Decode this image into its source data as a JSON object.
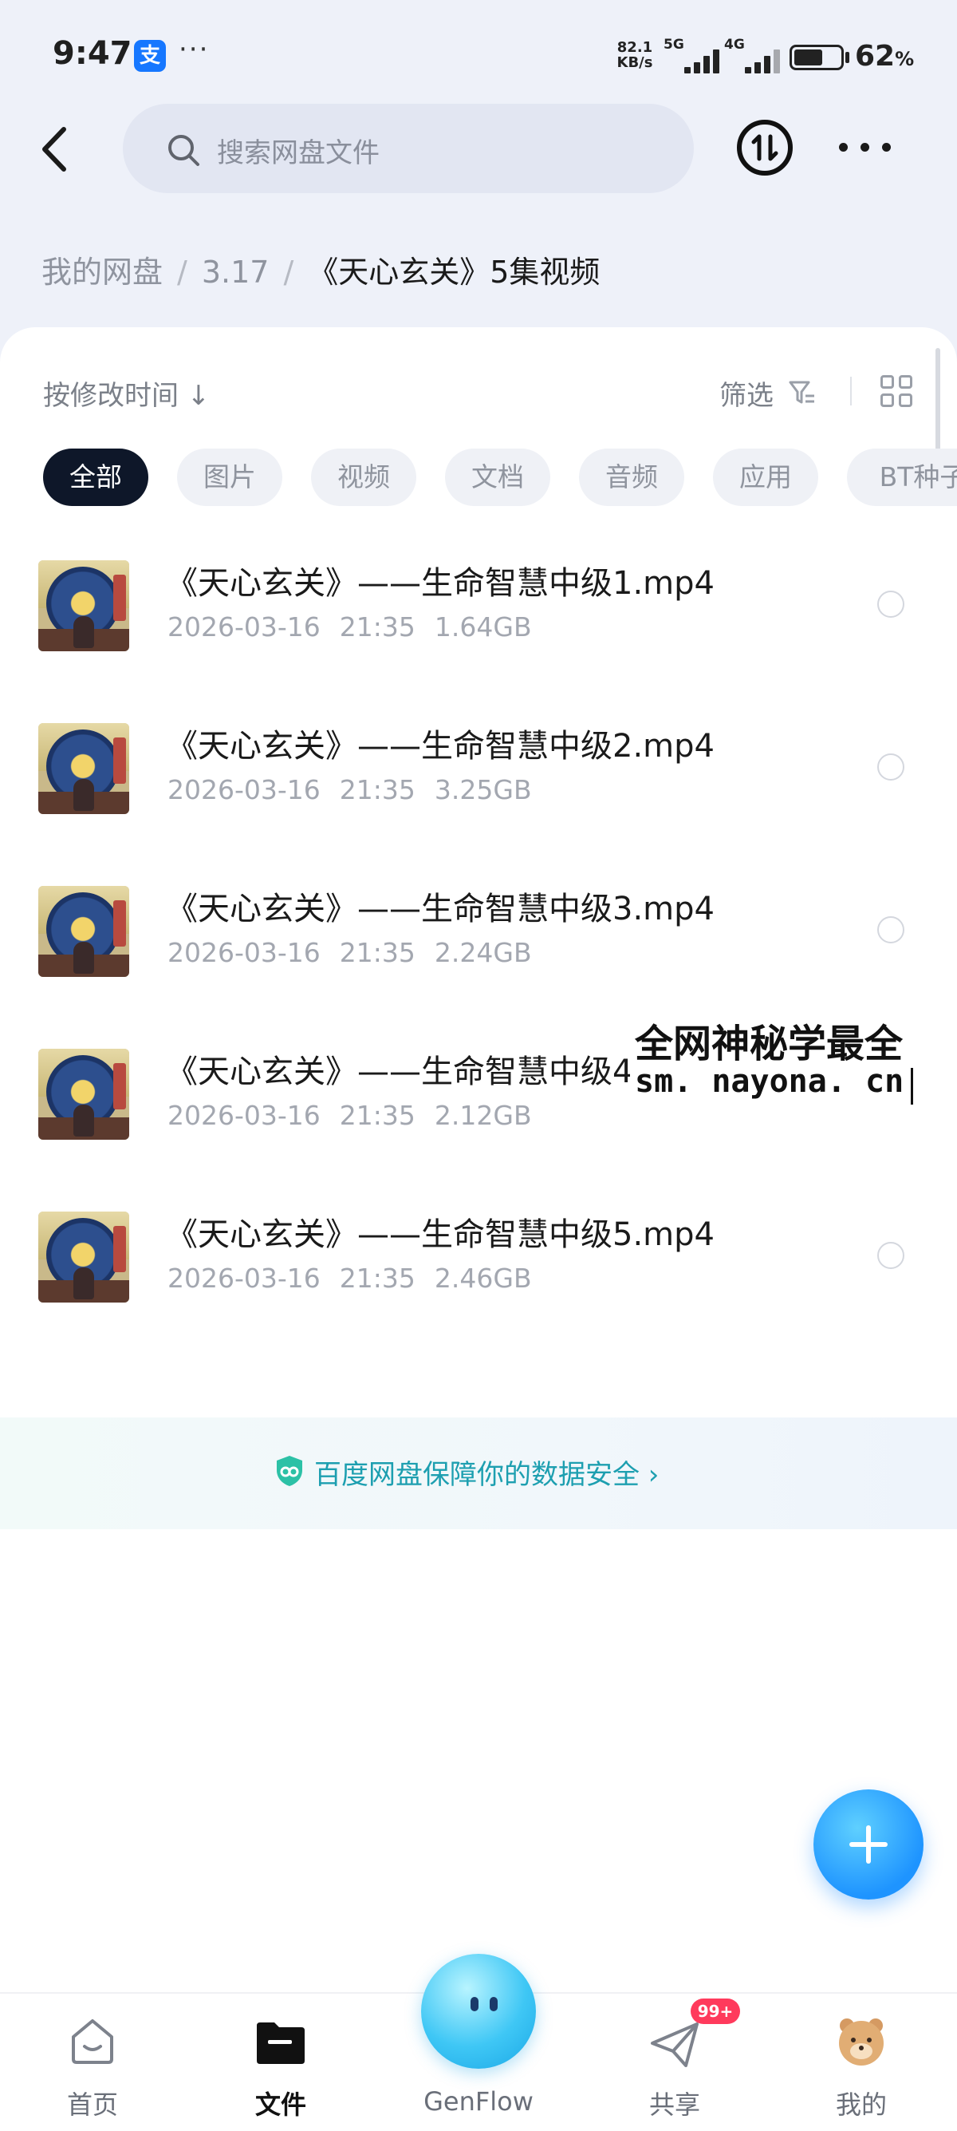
{
  "status_bar": {
    "time": "9:47",
    "app_badge": "支",
    "more": "···",
    "net_speed": [
      "82.1",
      "KB/s"
    ],
    "sim1": "5G",
    "sim2": "4G",
    "battery_percent": "62",
    "battery_unit": "%",
    "battery_level": 0.62
  },
  "header": {
    "search_placeholder": "搜索网盘文件",
    "transfer_icon": "transfer-icon",
    "more_icon": "more-icon"
  },
  "breadcrumb": {
    "items": [
      "我的网盘",
      "3.17"
    ],
    "separator": "/",
    "current": "《天心玄关》5集视频"
  },
  "toolbar": {
    "sort_label": "按修改时间 ↓",
    "filter_label": "筛选"
  },
  "categories": [
    "全部",
    "图片",
    "视频",
    "文档",
    "音频",
    "应用",
    "BT种子"
  ],
  "active_category": "全部",
  "files": [
    {
      "name": "《天心玄关》——生命智慧中级1.mp4",
      "date": "2026-03-16",
      "time": "21:35",
      "size": "1.64GB"
    },
    {
      "name": "《天心玄关》——生命智慧中级2.mp4",
      "date": "2026-03-16",
      "time": "21:35",
      "size": "3.25GB"
    },
    {
      "name": "《天心玄关》——生命智慧中级3.mp4",
      "date": "2026-03-16",
      "time": "21:35",
      "size": "2.24GB"
    },
    {
      "name": "《天心玄关》——生命智慧中级4.mp4",
      "date": "2026-03-16",
      "time": "21:35",
      "size": "2.12GB"
    },
    {
      "name": "《天心玄关》——生命智慧中级5.mp4",
      "date": "2026-03-16",
      "time": "21:35",
      "size": "2.46GB"
    }
  ],
  "watermark": {
    "line1": "全网神秘学最全",
    "line2": "sm. nayona. cn"
  },
  "security_banner": {
    "text": "百度网盘保障你的数据安全 ›"
  },
  "bottom_nav": {
    "home": "首页",
    "files": "文件",
    "genflow": "GenFlow",
    "share": "共享",
    "share_badge": "99+",
    "me": "我的"
  },
  "colors": {
    "accent": "#1e94ff",
    "active_chip": "#0e1729",
    "security_text": "#1d9fb0",
    "badge": "#ff3a5c"
  }
}
